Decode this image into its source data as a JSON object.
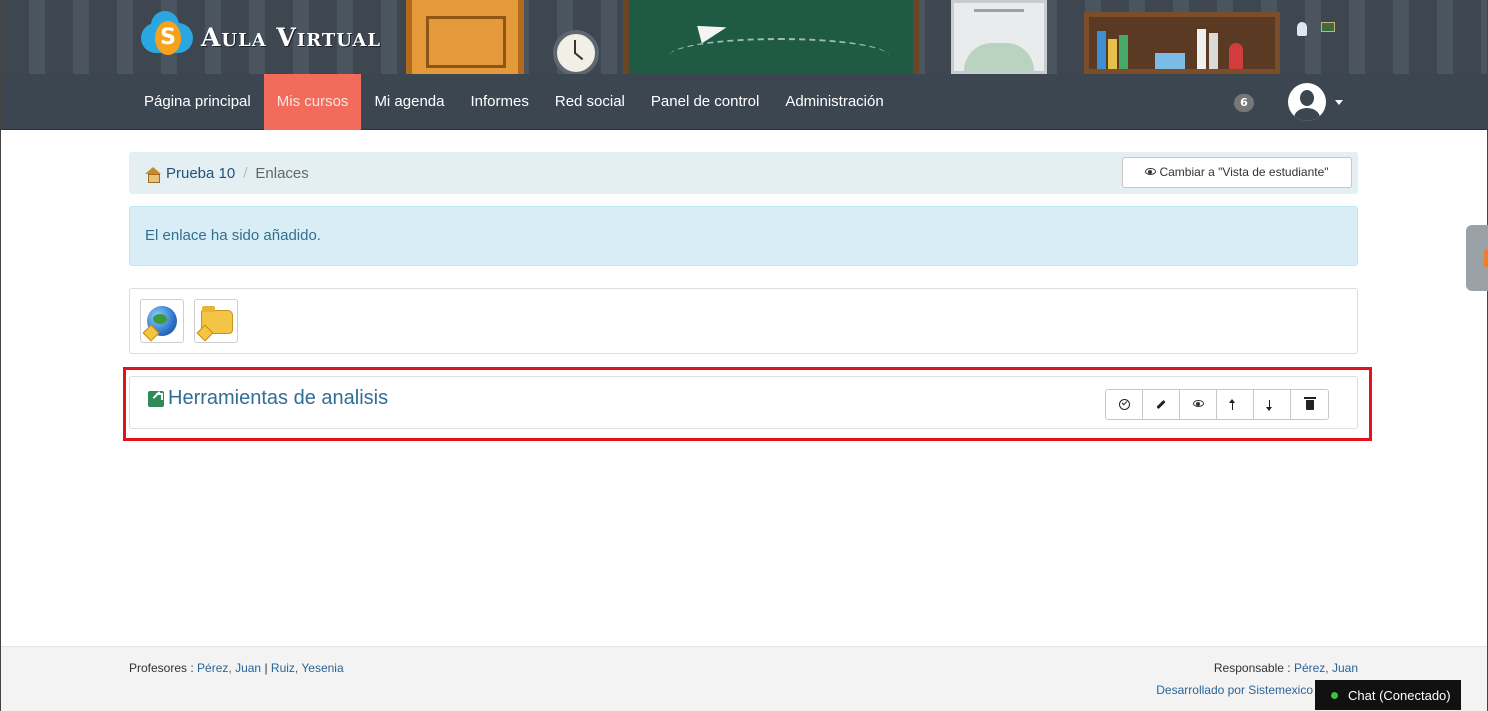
{
  "app": {
    "logo_text": "Aula Virtual",
    "logo_letter": "S"
  },
  "nav": {
    "items": [
      {
        "label": "Página principal",
        "active": false
      },
      {
        "label": "Mis cursos",
        "active": true
      },
      {
        "label": "Mi agenda",
        "active": false
      },
      {
        "label": "Informes",
        "active": false
      },
      {
        "label": "Red social",
        "active": false
      },
      {
        "label": "Panel de control",
        "active": false
      },
      {
        "label": "Administración",
        "active": false
      }
    ],
    "notification_count": "6"
  },
  "breadcrumb": {
    "home": "Prueba 10",
    "separator": "/",
    "current": "Enlaces",
    "student_view_button": "Cambiar a \"Vista de estudiante\""
  },
  "alert": {
    "message": "El enlace ha sido añadido."
  },
  "toolbar": {
    "buttons": [
      {
        "icon": "add-link-globe-icon"
      },
      {
        "icon": "add-category-folder-icon"
      }
    ]
  },
  "link_item": {
    "title": "Herramientas de analisis",
    "actions": [
      {
        "icon": "check-circle-icon"
      },
      {
        "icon": "pencil-icon"
      },
      {
        "icon": "eye-icon"
      },
      {
        "icon": "move-up-icon"
      },
      {
        "icon": "move-down-icon"
      },
      {
        "icon": "trash-icon"
      }
    ]
  },
  "footer": {
    "teachers_label": "Profesores :",
    "teacher_1": "Pérez, Juan",
    "teacher_sep": "|",
    "teacher_2": "Ruiz, Yesenia",
    "responsible_label": "Responsable :",
    "responsible": "Pérez, Juan",
    "developed_by": "Desarrollado por Sistemexico",
    "chat": "Chat (Conectado)"
  },
  "colors": {
    "nav_bg": "#3b4651",
    "nav_active": "#f26b5b",
    "alert_bg": "#d9edf7",
    "highlight_border": "#e0141b",
    "link_color": "#2f6e95"
  }
}
